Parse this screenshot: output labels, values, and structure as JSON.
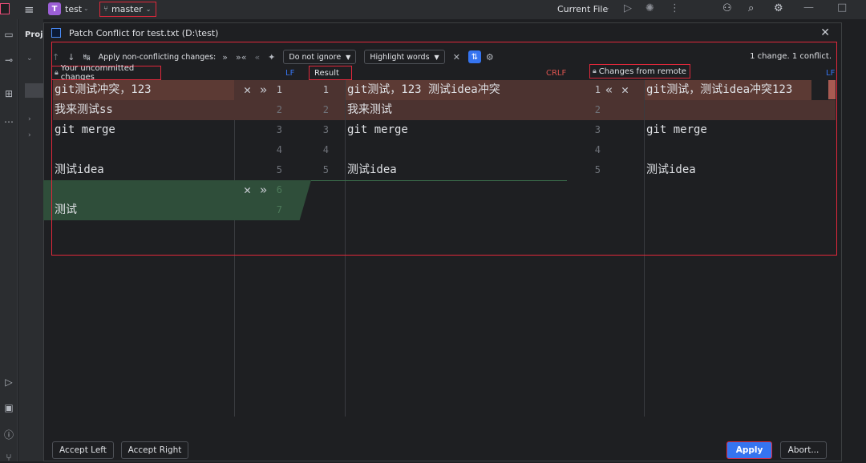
{
  "topbar": {
    "project_badge": "T",
    "project_name": "test",
    "branch": "master",
    "current_file": "Current File"
  },
  "left_panel": {
    "label": "Proj"
  },
  "dialog": {
    "title": "Patch Conflict for test.txt (D:\\test)",
    "toolbar": {
      "apply_nonconflicting": "Apply non-conflicting changes:",
      "ignore_option": "Do not ignore",
      "highlight_option": "Highlight words",
      "summary": "1 change. 1 conflict."
    },
    "headers": {
      "left": "Your uncommitted changes",
      "left_eol": "LF",
      "center": "Result",
      "center_eol": "CRLF",
      "right": "Changes from remote",
      "right_eol": "LF"
    },
    "left_lines": [
      "git测试冲突，123",
      "我来测试ss",
      "git merge",
      "",
      "测试idea",
      "",
      "测试"
    ],
    "left_numbers": [
      "1",
      "2",
      "3",
      "4",
      "5",
      "6",
      "7"
    ],
    "center_lines": [
      "git测试，123  测试idea冲突",
      "我来测试",
      "git merge",
      "",
      "测试idea"
    ],
    "center_numbers": [
      "1",
      "2",
      "3",
      "4",
      "5"
    ],
    "right_lines": [
      "git测试，测试idea冲突123",
      "",
      "git merge",
      "",
      "测试idea"
    ],
    "right_numbers": [
      "1",
      "2",
      "3",
      "4",
      "5"
    ],
    "buttons": {
      "accept_left": "Accept Left",
      "accept_right": "Accept Right",
      "apply": "Apply",
      "abort": "Abort..."
    }
  },
  "icons": {
    "up": "↑",
    "down": "↓",
    "apply_left": "»",
    "apply_right": "«",
    "close": "✕",
    "magic": "✦",
    "gear": "⚙"
  }
}
